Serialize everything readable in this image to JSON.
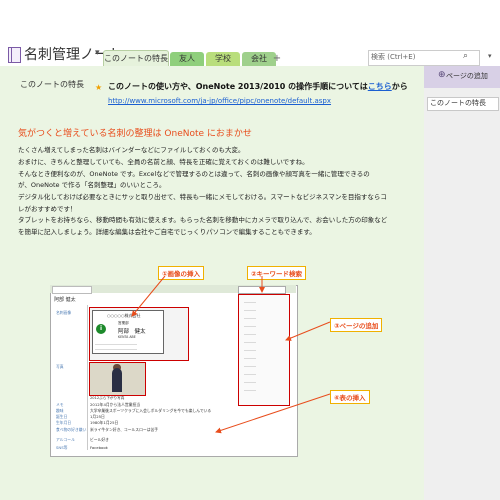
{
  "header": {
    "notebook_title": "名刺管理ノート",
    "tabs": [
      "このノートの特長",
      "友人",
      "学校",
      "会社"
    ],
    "add_tab": "+",
    "search_placeholder": "検索 (Ctrl+E)"
  },
  "sidebar": {
    "add_page_label": "ページの追加",
    "pages": [
      "このノートの特長"
    ]
  },
  "page": {
    "title": "このノートの特長",
    "intro_prefix": "このノートの使い方や、OneNote 2013/2010 の操作手順については",
    "intro_link": "こちら",
    "intro_suffix": "から",
    "url": "http://www.microsoft.com/ja-jp/office/pipc/onenote/default.aspx",
    "heading": "気がつくと増えている名刺の整理は OneNote におまかせ",
    "body_lines": [
      "たくさん増えてしまった名刺はバインダーなどにファイルしておくのも大変。",
      "おまけに、きちんと整理していても、全員の名前と顔、特長を正確に覚えておくのは難しいですね。",
      "そんなとき便利なのが、OneNote です。Excelなどで管理するのとは違って、名刺の画像や顔写真を一緒に管理できるの",
      "が、OneNote で作る「名刺整理」のいいところ。",
      "デジタル化しておけば必要なときにサッと取り出せて、特長も一緒にメモしておける。スマートなビジネスマンを目指すならコ",
      "レがおすすめです！",
      "タブレットをお持ちなら、移動時間も有効に使えます。もらった名刺を移動中にカメラで取り込んで、お会いした方の印象など",
      "を簡単に記入しましょう。詳細な編集は会社やご自宅でじっくりパソコンで編集することもできます。"
    ]
  },
  "callouts": {
    "c1": "①画像の挿入",
    "c2": "②キーワード検索",
    "c3": "③ページの追加",
    "c4": "④表の挿入"
  },
  "inset": {
    "title": "阿部 健太",
    "card_company": "○○○○○株式会社",
    "card_dept": "営業部",
    "card_name": "阿部　健太",
    "card_roman": "KENTA ABE",
    "card_logo": "i",
    "photo_caption": "2012ぶら下がり写真",
    "labels": [
      "名刺画像",
      "写真",
      "メモ",
      "趣味",
      "誕生日",
      "生年月日",
      "食べ物の好き嫌い",
      "アルコール",
      "SNS等"
    ],
    "values": [
      "",
      "",
      "2012年4月から法人営業担当",
      "大学卒業後スポーツクラブに入会しボルダリングを今でも楽しんでいる",
      "1月25日",
      "1980年1月25日",
      "米ライ牛タン好き、コールスローは苦手",
      "ビール好き",
      "Facebook"
    ]
  },
  "colors": {
    "accent_purple": "#7b5aa6",
    "page_green": "#ebf5e3",
    "heading_orange": "#e84d1c",
    "link_blue": "#1b5fd1",
    "callout_red": "#cc0000"
  }
}
